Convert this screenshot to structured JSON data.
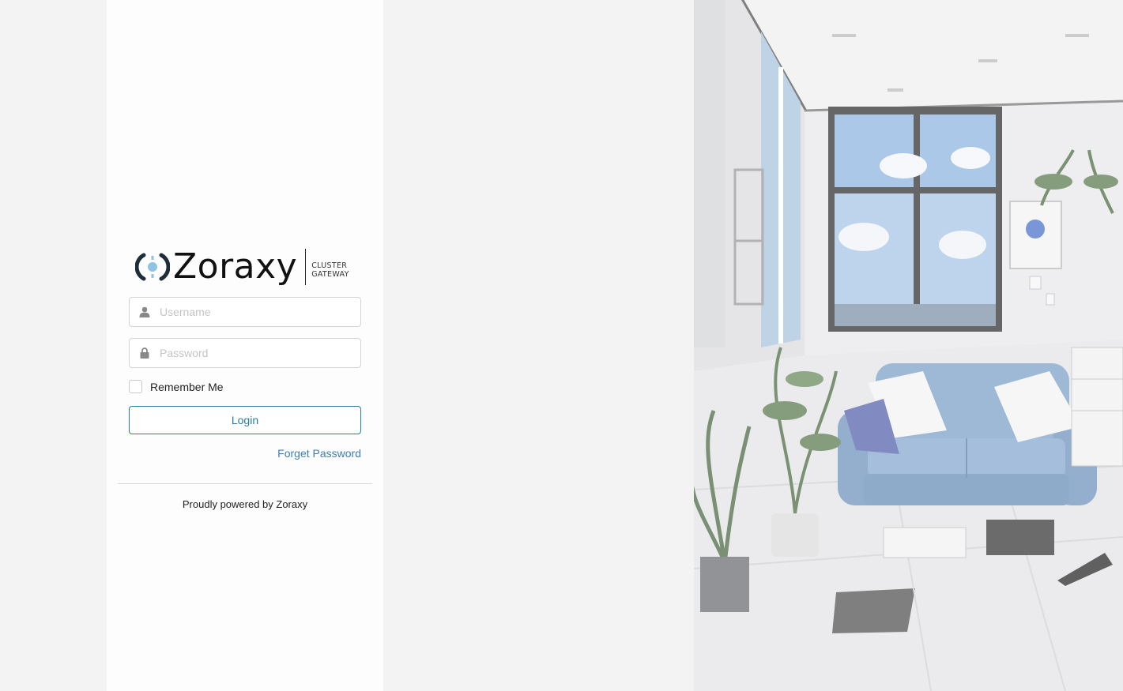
{
  "brand": {
    "name": "Zoraxy",
    "tagline_line1": "CLUSTER",
    "tagline_line2": "GATEWAY",
    "logo_icon": "zoraxy-logo-icon",
    "colors": {
      "accent": "#2a7ea0",
      "logo_dark": "#1f2d3a",
      "logo_light": "#8fc3e6"
    }
  },
  "form": {
    "username_placeholder": "Username",
    "password_placeholder": "Password",
    "username_icon": "user-icon",
    "password_icon": "lock-icon",
    "remember_label": "Remember Me",
    "remember_checked": false,
    "login_label": "Login",
    "forget_label": "Forget Password"
  },
  "footer": {
    "text": "Proudly powered by Zoraxy"
  },
  "background": {
    "description_icon": "living-room-illustration"
  }
}
